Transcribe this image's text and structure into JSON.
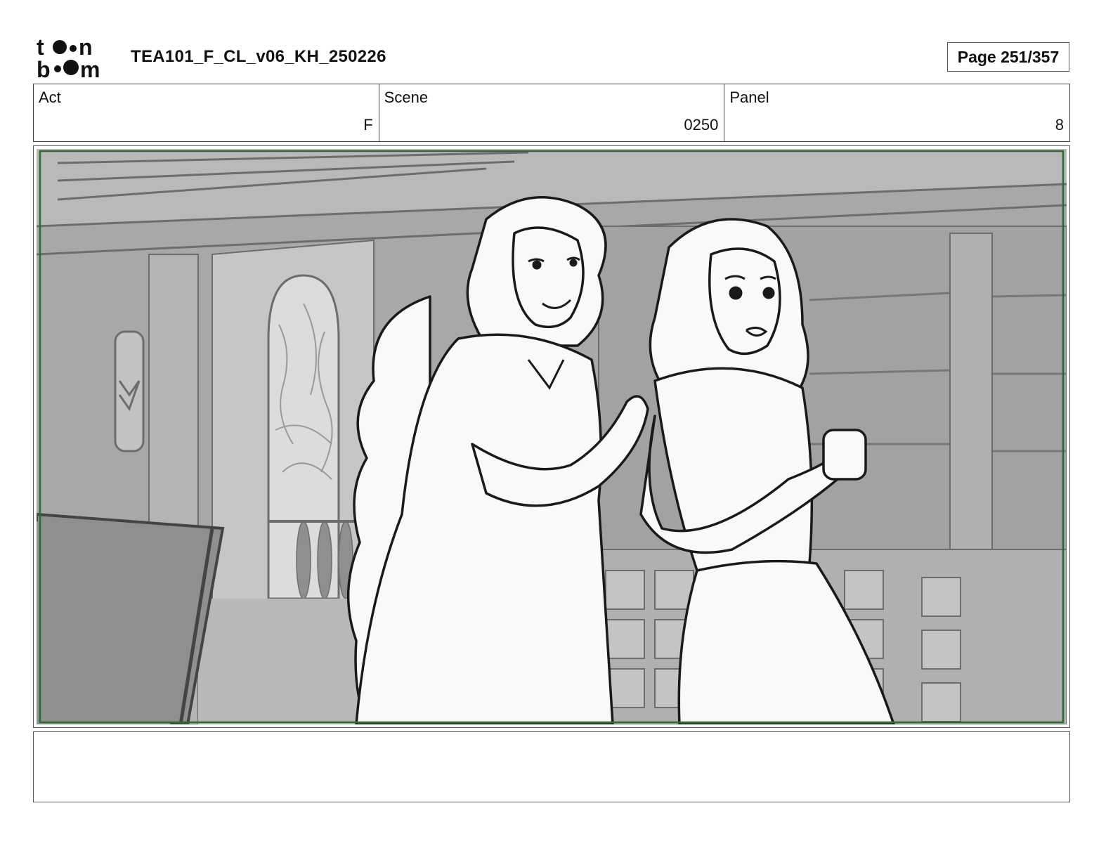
{
  "header": {
    "logo_alt": "toon boom",
    "document_title": "TEA101_F_CL_v06_KH_250226",
    "page_label": "Page 251/357"
  },
  "info": {
    "act": {
      "label": "Act",
      "value": "F"
    },
    "scene": {
      "label": "Scene",
      "value": "0250"
    },
    "panel": {
      "label": "Panel",
      "value": "8"
    }
  },
  "colors": {
    "safe_frame": "#2e6b2e",
    "background_gray": "#a7a7a7",
    "character_fill": "#f8f9fb",
    "line_art": "#1a1a1a"
  },
  "notes": {
    "text": ""
  }
}
